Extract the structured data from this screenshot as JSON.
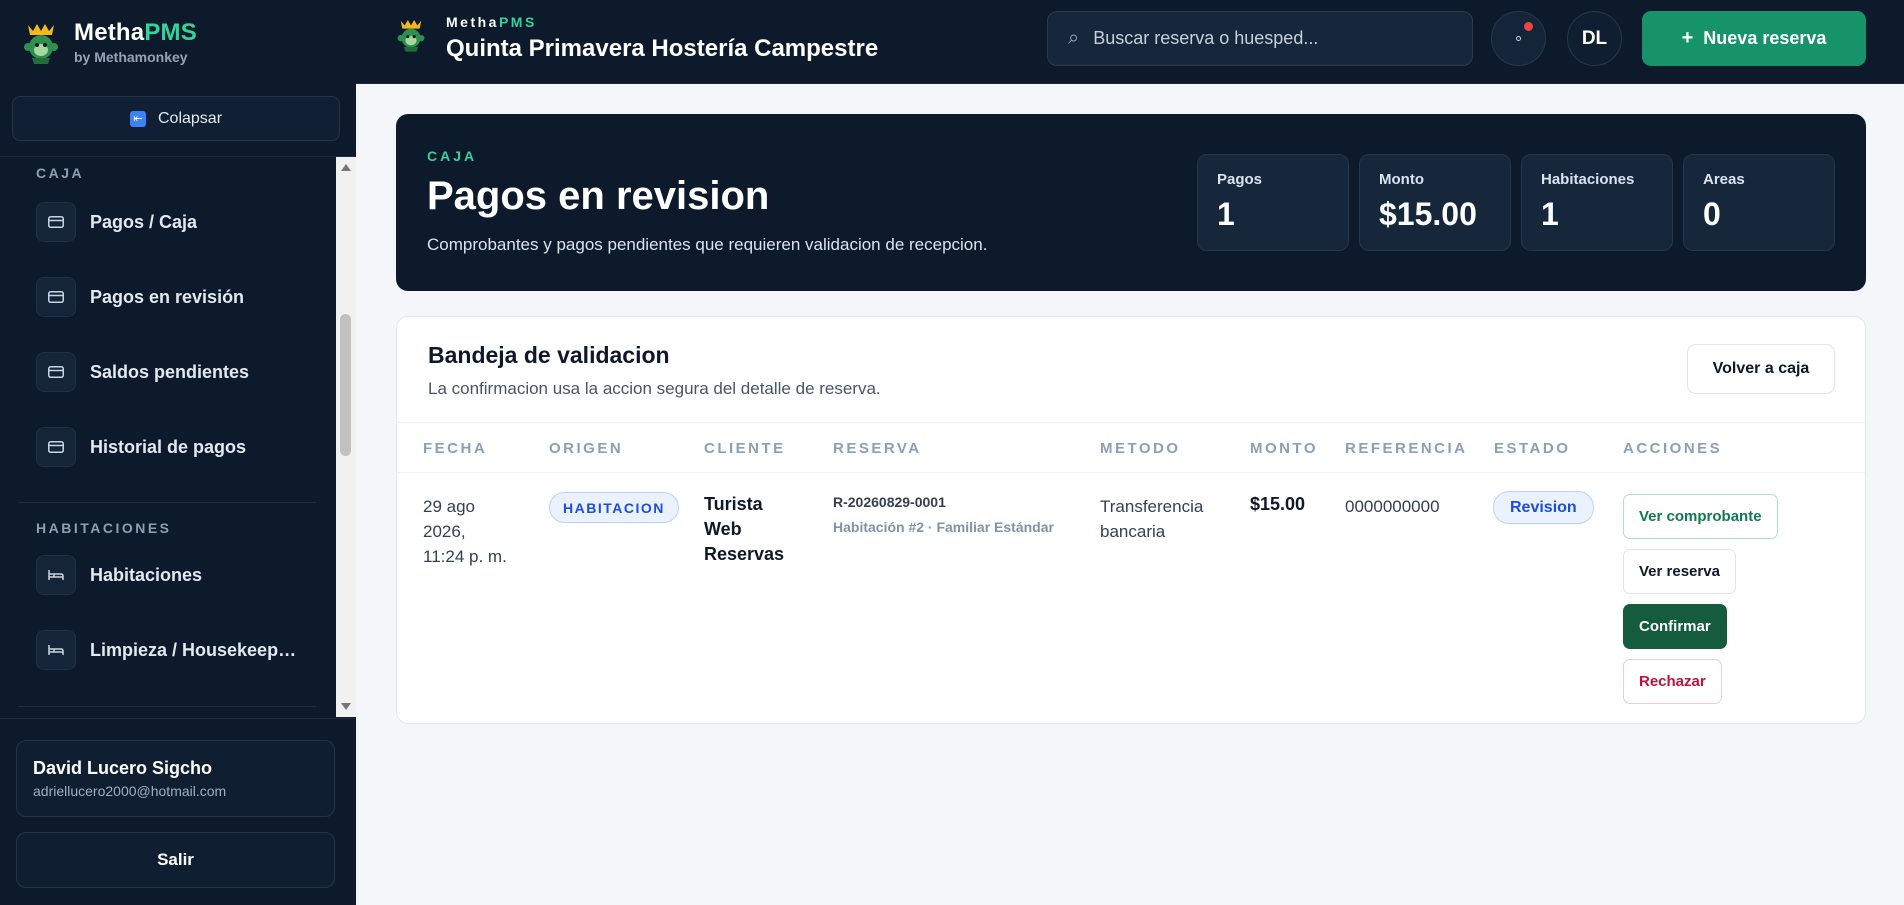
{
  "sidebar": {
    "brand_prefix": "Metha",
    "brand_suffix": "PMS",
    "brand_sub": "by Methamonkey",
    "collapse_label": "Colapsar",
    "sections": [
      {
        "title": "CAJA",
        "items": [
          {
            "label": "Pagos / Caja",
            "icon": "credit-card-icon"
          },
          {
            "label": "Pagos en revisión",
            "icon": "credit-card-icon"
          },
          {
            "label": "Saldos pendientes",
            "icon": "credit-card-icon"
          },
          {
            "label": "Historial de pagos",
            "icon": "credit-card-icon"
          }
        ]
      },
      {
        "title": "HABITACIONES",
        "items": [
          {
            "label": "Habitaciones",
            "icon": "bed-icon"
          },
          {
            "label": "Limpieza / Housekeeping",
            "icon": "bed-icon"
          }
        ]
      }
    ],
    "user": {
      "name": "David Lucero Sigcho",
      "email": "adriellucero2000@hotmail.com"
    },
    "logout_label": "Salir"
  },
  "topbar": {
    "brand_prefix": "Metha",
    "brand_suffix": "PMS",
    "property_name": "Quinta Primavera Hostería Campestre",
    "search_placeholder": "Buscar reserva o huesped...",
    "avatar_initials": "DL",
    "new_reservation_label": "Nueva reserva",
    "colors": {
      "accent": "#17936a",
      "notification": "#ef4444",
      "navy": "#0c1a2b"
    }
  },
  "hero": {
    "kicker": "CAJA",
    "title": "Pagos en revision",
    "subtitle": "Comprobantes y pagos pendientes que requieren validacion de recepcion.",
    "stats": [
      {
        "label": "Pagos",
        "value": "1"
      },
      {
        "label": "Monto",
        "value": "$15.00"
      },
      {
        "label": "Habitaciones",
        "value": "1"
      },
      {
        "label": "Areas",
        "value": "0"
      }
    ]
  },
  "inbox": {
    "title": "Bandeja de validacion",
    "subtitle": "La confirmacion usa la accion segura del detalle de reserva.",
    "back_label": "Volver a caja",
    "columns": [
      "FECHA",
      "ORIGEN",
      "CLIENTE",
      "RESERVA",
      "METODO",
      "MONTO",
      "REFERENCIA",
      "ESTADO",
      "ACCIONES"
    ],
    "rows": [
      {
        "fecha_line1": "29 ago",
        "fecha_line2": "2026,",
        "fecha_line3": "11:24 p. m.",
        "origen": "HABITACION",
        "cliente_line1": "Turista",
        "cliente_line2": "Web",
        "cliente_line3": "Reservas",
        "reserva_code": "R-20260829-0001",
        "reserva_room": "Habitación #2 · Familiar Estándar",
        "metodo_line1": "Transferencia",
        "metodo_line2": "bancaria",
        "monto": "$15.00",
        "referencia": "0000000000",
        "estado": "Revision",
        "actions": {
          "view_receipt": "Ver comprobante",
          "view_reservation": "Ver reserva",
          "confirm": "Confirmar",
          "reject": "Rechazar"
        }
      }
    ]
  }
}
